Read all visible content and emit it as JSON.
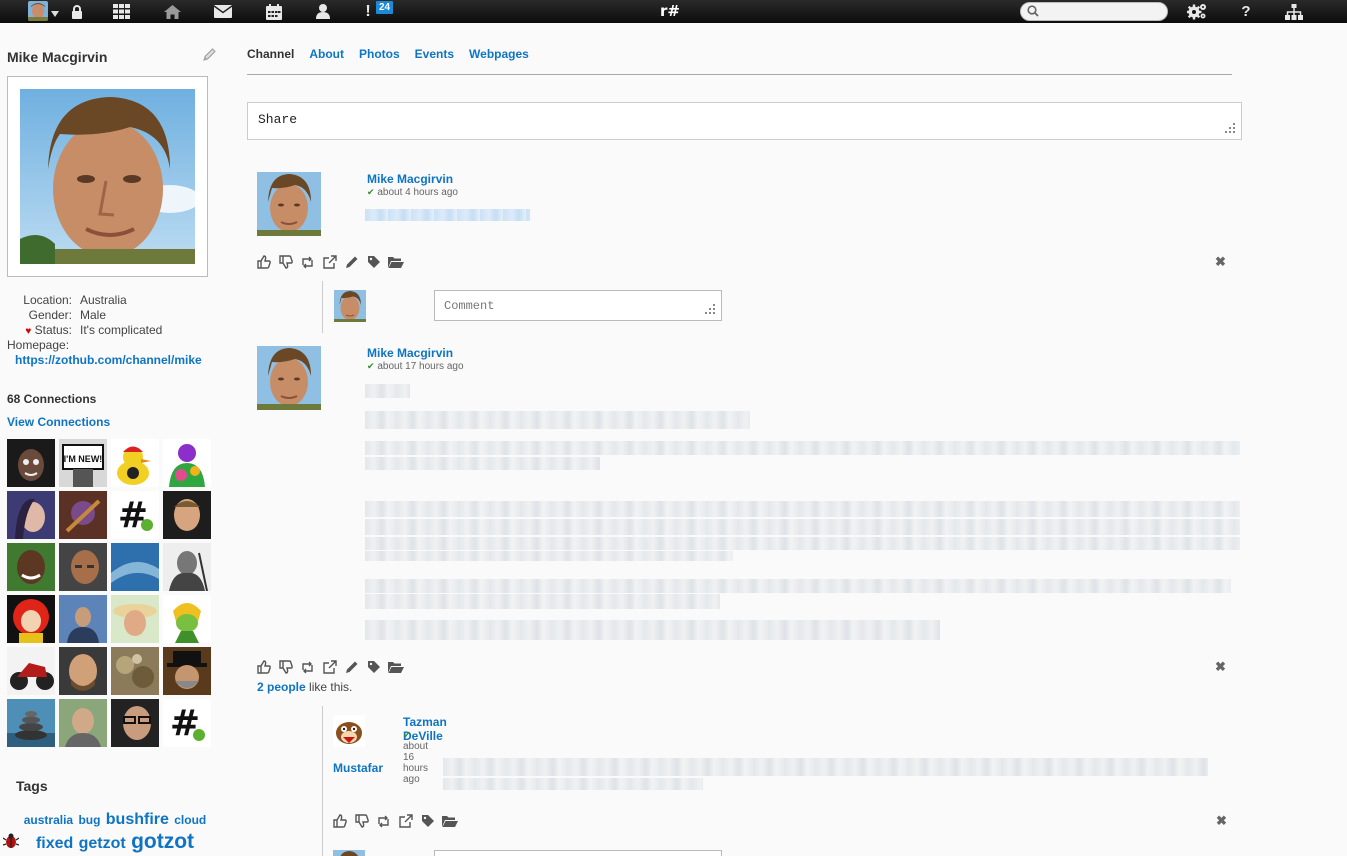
{
  "nav": {
    "brand": "r#",
    "notifications_count": "24",
    "search_placeholder": "",
    "icons": [
      "avatar-menu",
      "lock-icon",
      "apps-icon",
      "home-icon",
      "mail-icon",
      "calendar-icon",
      "profile-icon",
      "notifications-icon",
      "settings-icon",
      "help-icon",
      "sitemap-icon"
    ]
  },
  "profile": {
    "name": "Mike Macgirvin",
    "location_label": "Location:",
    "location": "Australia",
    "gender_label": "Gender:",
    "gender": "Male",
    "status_label": "Status:",
    "status": "It's complicated",
    "homepage_label": "Homepage:",
    "homepage": "https://zothub.com/channel/mike",
    "connections_count": "68 Connections",
    "view_connections": "View Connections"
  },
  "tags": {
    "title": "Tags",
    "items": [
      {
        "label": "australia",
        "size": 12
      },
      {
        "label": "bug",
        "size": 12
      },
      {
        "label": "bushfire",
        "size": 16
      },
      {
        "label": "cloud",
        "size": 12
      },
      {
        "label": "fixed",
        "size": 16
      },
      {
        "label": "getzot",
        "size": 16
      },
      {
        "label": "gotzot",
        "size": 21
      }
    ]
  },
  "tabs": [
    {
      "label": "Channel",
      "active": true
    },
    {
      "label": "About",
      "active": false
    },
    {
      "label": "Photos",
      "active": false
    },
    {
      "label": "Events",
      "active": false
    },
    {
      "label": "Webpages",
      "active": false
    }
  ],
  "share": {
    "placeholder": "Share"
  },
  "posts": [
    {
      "author": "Mike Macgirvin",
      "time": "about 4 hours ago"
    },
    {
      "author": "Mike Macgirvin",
      "time": "about 17 hours ago",
      "likes_count": "2 people",
      "likes_suffix": " like this."
    }
  ],
  "comment": {
    "placeholder": "Comment"
  },
  "reply": {
    "author": "Tazman DeVille",
    "time": "about 16 hours ago",
    "location": "Mustafar"
  },
  "colors": {
    "link": "#0f74c4",
    "nav_bg": "#111111",
    "badge": "#1a8ad9"
  }
}
